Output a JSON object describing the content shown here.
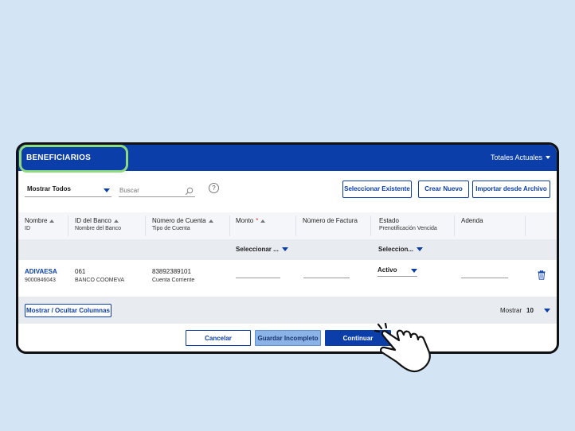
{
  "header": {
    "title": "BENEFICIARIOS",
    "totals_label": "Totales Actuales"
  },
  "toolbar": {
    "show_select": "Mostrar Todos",
    "search_placeholder": "Buscar",
    "help_icon": "?",
    "buttons": {
      "select_existing": "Seleccionar Existente",
      "create_new": "Crear Nuevo",
      "import_file": "Importar desde Archivo"
    }
  },
  "table": {
    "headers": [
      {
        "top": "Nombre",
        "bottom": "ID"
      },
      {
        "top": "ID del Banco",
        "bottom": "Nombre del Banco"
      },
      {
        "top": "Número de Cuenta",
        "bottom": "Tipo de Cuenta"
      },
      {
        "top": "Monto",
        "required": "*",
        "bottom": ""
      },
      {
        "top": "Número de Factura",
        "bottom": ""
      },
      {
        "top": "Estado",
        "bottom": "Prenotificación Vencida"
      },
      {
        "top": "Adenda",
        "bottom": ""
      }
    ],
    "filters": {
      "monto": "Seleccionar ...",
      "estado": "Seleccion..."
    },
    "rows": [
      {
        "name": "ADIVAESA",
        "id": "9000846043",
        "bank_id": "061",
        "bank_name": "BANCO COOMEVA",
        "account_number": "83892389101",
        "account_type": "Cuenta Corriente",
        "status": "Activo"
      }
    ]
  },
  "footer": {
    "columns_button": "Mostrar / Ocultar Columnas",
    "show_label": "Mostrar",
    "show_value": "10"
  },
  "actions": {
    "cancel": "Cancelar",
    "save_draft": "Guardar Incompleto",
    "continue": "Continuar"
  },
  "colors": {
    "brand_blue": "#0b3ea8",
    "highlight_green": "#8fdc7e",
    "background": "#d3e4f5"
  }
}
